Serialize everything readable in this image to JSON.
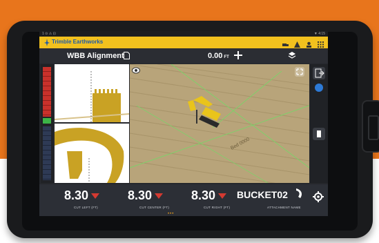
{
  "status_bar": {
    "left": "1 ⊙ ⚠ ⊡",
    "right": "▼ 4:15"
  },
  "app": {
    "brand": "Trimble Earthworks"
  },
  "toolbar": {
    "title": "WBB Alignment",
    "offset_value": "0.00",
    "offset_unit": "FT"
  },
  "scene": {
    "surface_label": "Bed 0000"
  },
  "readouts": [
    {
      "value": "8.30",
      "caption": "CUT LEFT (FT)"
    },
    {
      "value": "8.30",
      "caption": "CUT CENTER (FT)"
    },
    {
      "value": "8.30",
      "caption": "CUT RIGHT (FT)"
    }
  ],
  "attachment": {
    "name": "BUCKET02",
    "caption": "ATTACHMENT NAME"
  },
  "pager_dots": "•••",
  "colors": {
    "accent_yellow": "#f2c11e",
    "orange_bg": "#e8751c",
    "cut_red": "#d43a31",
    "on_grade_green": "#3cb447"
  },
  "icons": [
    "document-icon",
    "plus-icon",
    "layers-icon",
    "eye-icon",
    "expand-icon",
    "exit-icon",
    "chat-icon",
    "bucket-icon",
    "settings-icon"
  ]
}
